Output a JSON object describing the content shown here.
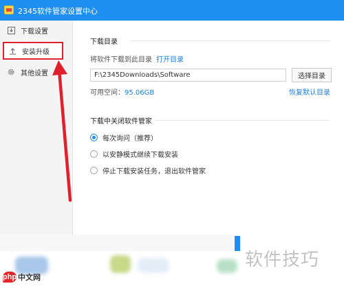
{
  "window": {
    "title": "2345软件管家设置中心"
  },
  "sidebar": {
    "items": [
      {
        "label": "下载设置",
        "icon": "download-box-icon"
      },
      {
        "label": "安装升级",
        "icon": "upload-arrow-icon"
      },
      {
        "label": "其他设置",
        "icon": "gear-icon"
      }
    ]
  },
  "download_dir": {
    "title": "下载目录",
    "hint": "将软件下载到此目录",
    "open_link": "打开目录",
    "path_value": "F:\\2345Downloads\\Software",
    "choose_button": "选择目录",
    "free_space_label": "可用空间：",
    "free_space_value": "95.06GB",
    "restore_link": "恢复默认目录"
  },
  "close_behavior": {
    "title": "下载中关闭软件管家",
    "options": [
      {
        "label": "每次询问（推荐）",
        "checked": true
      },
      {
        "label": "以安静模式继续下载安装",
        "checked": false
      },
      {
        "label": "停止下载安装任务，退出软件管家",
        "checked": false
      }
    ]
  },
  "watermark": "软件技巧",
  "logo": {
    "badge": "php",
    "text": "中文网"
  },
  "colors": {
    "accent": "#1e8ff0",
    "highlight": "#e0202c",
    "link": "#1e7fd8"
  }
}
